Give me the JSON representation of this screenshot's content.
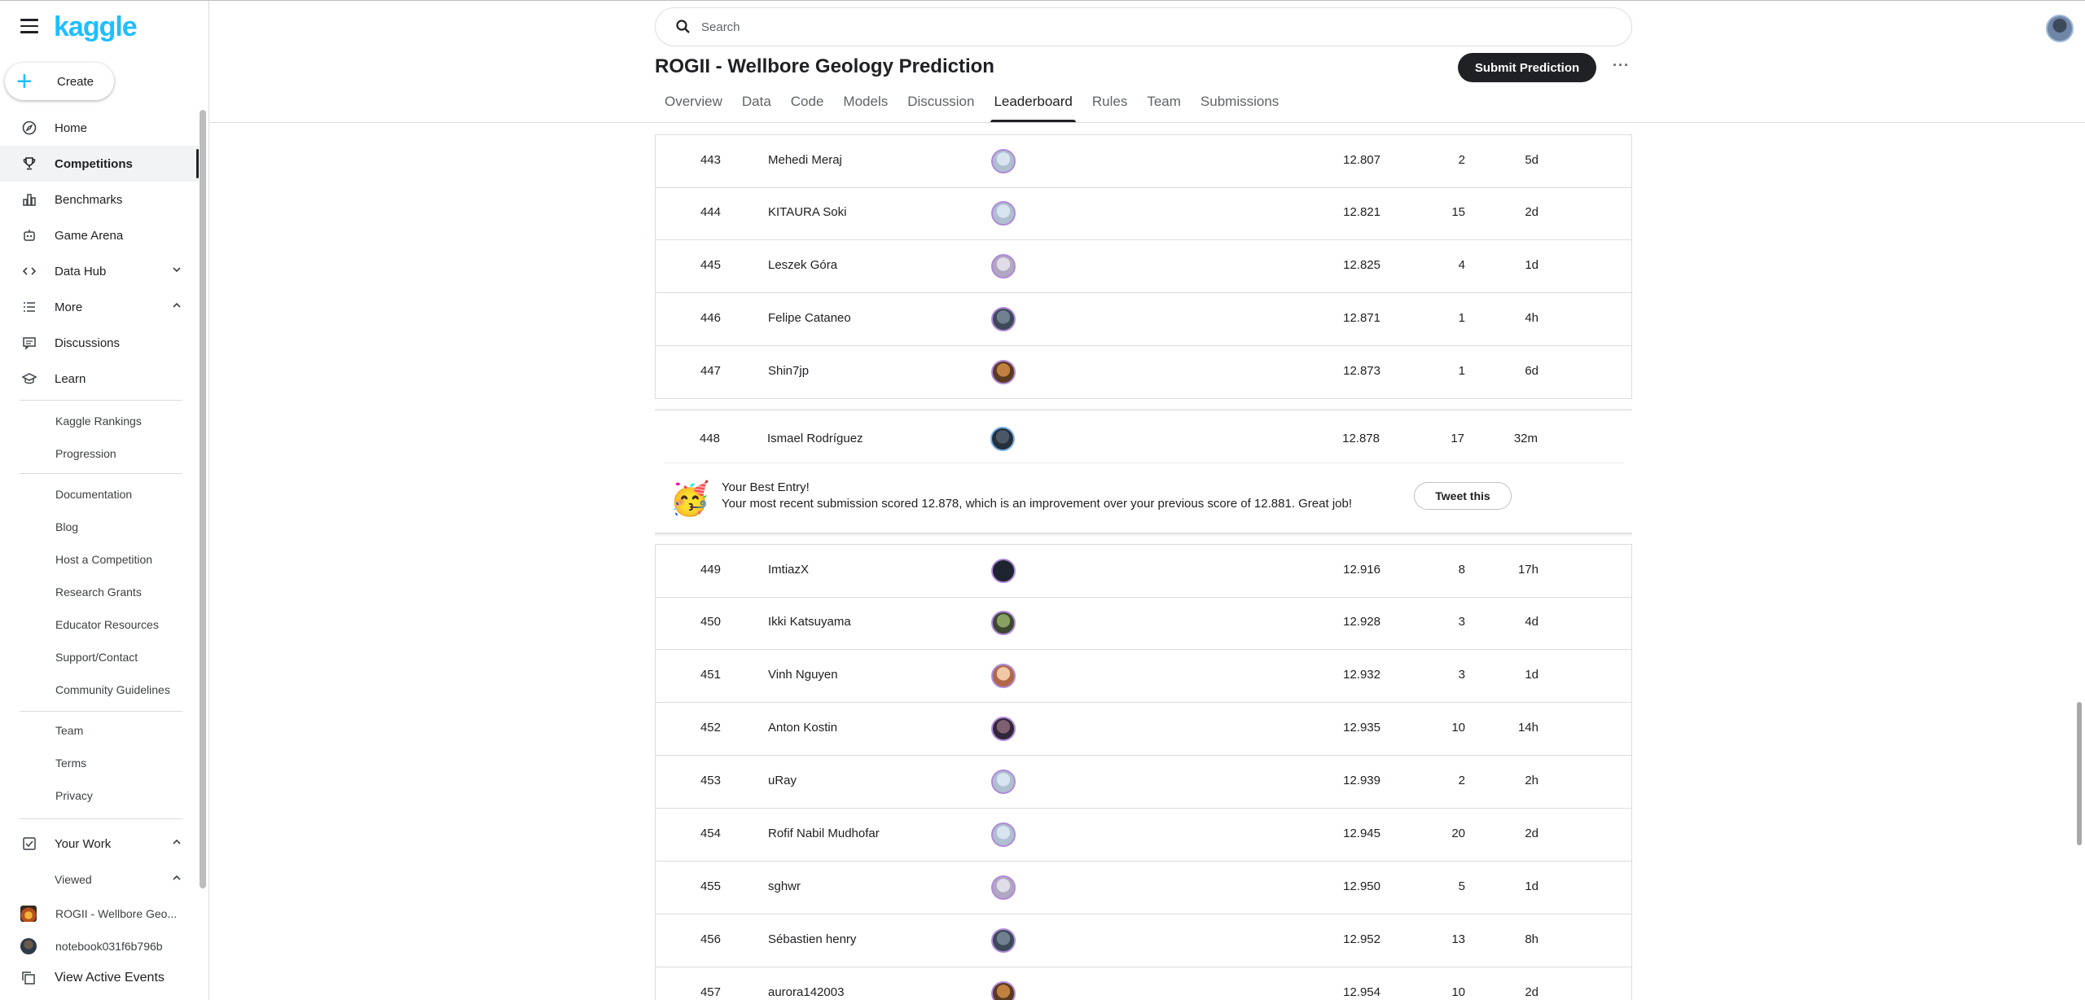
{
  "brand": {
    "logo": "kaggle"
  },
  "sidebar": {
    "create_label": "Create",
    "nav": [
      {
        "label": "Home",
        "icon": "compass-icon"
      },
      {
        "label": "Competitions",
        "icon": "trophy-icon",
        "active": true
      },
      {
        "label": "Benchmarks",
        "icon": "bar-chart-icon"
      },
      {
        "label": "Game Arena",
        "icon": "robot-icon"
      },
      {
        "label": "Data Hub",
        "icon": "code-icon"
      },
      {
        "label": "More",
        "icon": "list-icon"
      },
      {
        "label": "Discussions",
        "icon": "comment-icon"
      },
      {
        "label": "Learn",
        "icon": "school-icon"
      }
    ],
    "more_links": [
      "Kaggle Rankings",
      "Progression"
    ],
    "resource_links": [
      "Documentation",
      "Blog",
      "Host a Competition",
      "Research Grants",
      "Educator Resources",
      "Support/Contact",
      "Community Guidelines"
    ],
    "legal_links": [
      "Team",
      "Terms",
      "Privacy"
    ],
    "your_work": "Your Work",
    "viewed": "Viewed",
    "viewed_items": [
      "ROGII - Wellbore Geo...",
      "notebook031f6b796b"
    ],
    "view_active_events": "View Active Events"
  },
  "header": {
    "search_placeholder": "Search",
    "title": "ROGII - Wellbore Geology Prediction",
    "submit_label": "Submit Prediction",
    "more_label": "···",
    "tabs": [
      "Overview",
      "Data",
      "Code",
      "Models",
      "Discussion",
      "Leaderboard",
      "Rules",
      "Team",
      "Submissions"
    ],
    "active_tab": "Leaderboard"
  },
  "leaderboard": {
    "rows_before": [
      {
        "rank": "443",
        "name": "Mehedi Meraj",
        "score": "12.807",
        "entries": "2",
        "last": "5d"
      },
      {
        "rank": "444",
        "name": "KITAURA Soki",
        "score": "12.821",
        "entries": "15",
        "last": "2d"
      },
      {
        "rank": "445",
        "name": "Leszek Góra",
        "score": "12.825",
        "entries": "4",
        "last": "1d"
      },
      {
        "rank": "446",
        "name": "Felipe Cataneo",
        "score": "12.871",
        "entries": "1",
        "last": "4h"
      },
      {
        "rank": "447",
        "name": "Shin7jp",
        "score": "12.873",
        "entries": "1",
        "last": "6d"
      }
    ],
    "best_entry": {
      "rank": "448",
      "name": "Ismael Rodríguez",
      "score": "12.878",
      "entries": "17",
      "last": "32m",
      "emoji": "🥳",
      "title": "Your Best Entry!",
      "message": "Your most recent submission scored 12.878, which is an improvement over your previous score of 12.881. Great job!",
      "tweet_label": "Tweet this"
    },
    "rows_after": [
      {
        "rank": "449",
        "name": "ImtiazX",
        "score": "12.916",
        "entries": "8",
        "last": "17h"
      },
      {
        "rank": "450",
        "name": "Ikki Katsuyama",
        "score": "12.928",
        "entries": "3",
        "last": "4d"
      },
      {
        "rank": "451",
        "name": "Vinh Nguyen",
        "score": "12.932",
        "entries": "3",
        "last": "1d"
      },
      {
        "rank": "452",
        "name": "Anton Kostin",
        "score": "12.935",
        "entries": "10",
        "last": "14h"
      },
      {
        "rank": "453",
        "name": "uRay",
        "score": "12.939",
        "entries": "2",
        "last": "2h"
      },
      {
        "rank": "454",
        "name": "Rofif Nabil Mudhofar",
        "score": "12.945",
        "entries": "20",
        "last": "2d"
      },
      {
        "rank": "455",
        "name": "sghwr",
        "score": "12.950",
        "entries": "5",
        "last": "1d"
      },
      {
        "rank": "456",
        "name": "Sébastien henry",
        "score": "12.952",
        "entries": "13",
        "last": "8h"
      },
      {
        "rank": "457",
        "name": "aurora142003",
        "score": "12.954",
        "entries": "10",
        "last": "2d"
      }
    ]
  }
}
